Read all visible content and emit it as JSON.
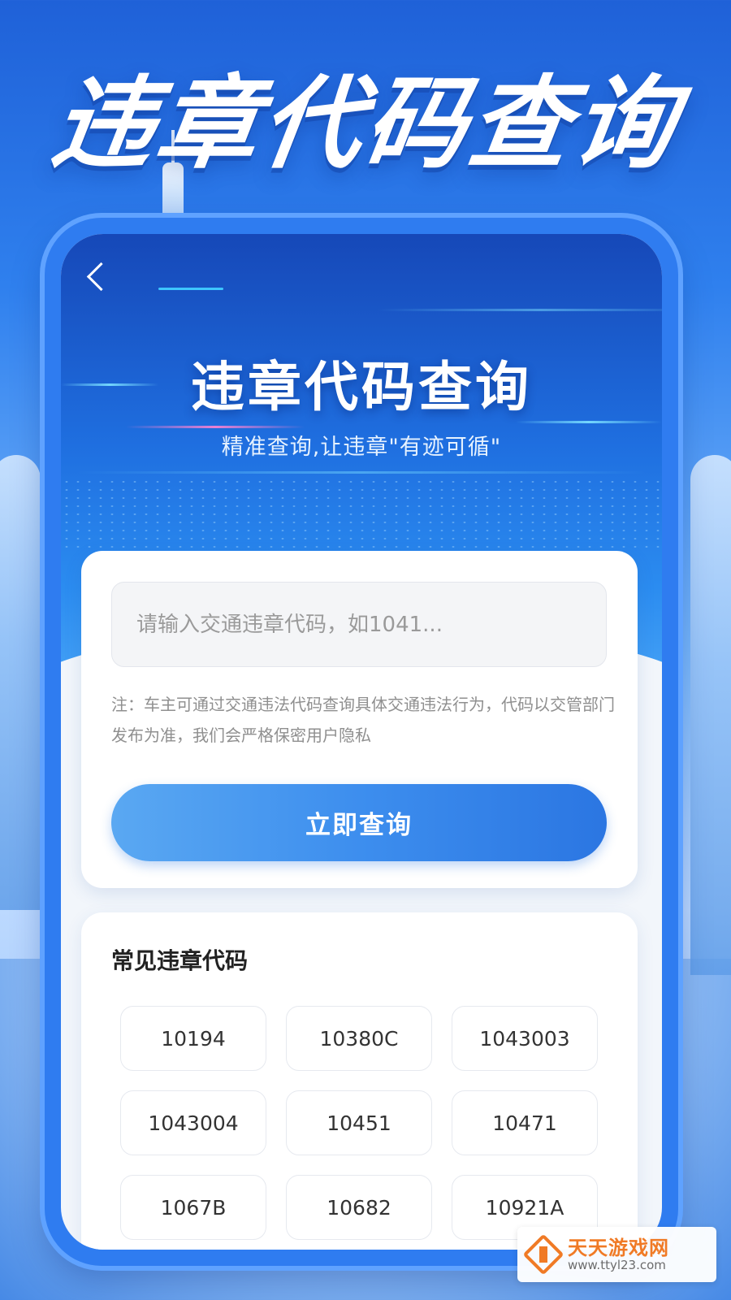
{
  "headline": "违章代码查询",
  "app": {
    "title": "违章代码查询",
    "subtitle": "精准查询,让违章\"有迹可循\""
  },
  "search": {
    "placeholder": "请输入交通违章代码，如1041...",
    "notice": "注：车主可通过交通违法代码查询具体交通违法行为，代码以交管部门发布为准，我们会严格保密用户隐私",
    "button_label": "立即查询"
  },
  "common_codes": {
    "title": "常见违章代码",
    "items": [
      "10194",
      "10380C",
      "1043003",
      "1043004",
      "10451",
      "10471",
      "1067B",
      "10682",
      "10921A"
    ]
  },
  "watermark": {
    "name": "天天游戏网",
    "url": "www.ttyl23.com"
  },
  "icons": {
    "back": "chevron-left-icon",
    "watermark_logo": "ttyl-logo-icon"
  },
  "colors": {
    "primary": "#2b76e2",
    "primary_light": "#5aa8f2",
    "header_top": "#1648b8",
    "page_bg": "#f2f6fb",
    "watermark_orange": "#f07a25"
  }
}
